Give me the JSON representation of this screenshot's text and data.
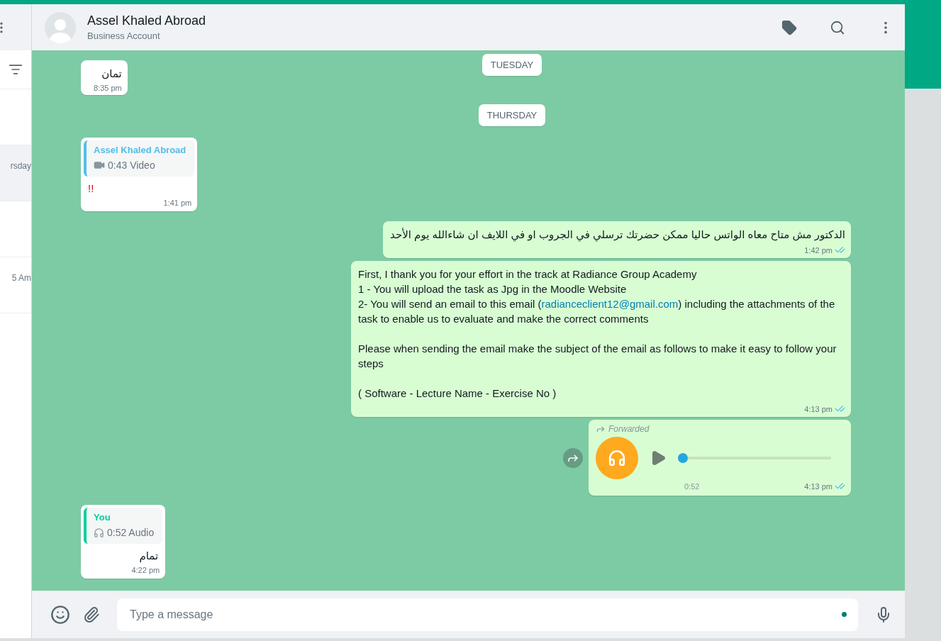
{
  "sidebar": {
    "items": [
      {
        "selected": false
      },
      {
        "time": "rsday",
        "selected": true
      },
      {
        "selected": false
      },
      {
        "time": "5 Am",
        "selected": false
      }
    ]
  },
  "header": {
    "name": "Assel Khaled Abroad",
    "subtitle": "Business Account"
  },
  "messages": [
    {
      "kind": "incoming_text",
      "text": "تمان",
      "time": "8:35 pm"
    },
    {
      "kind": "date",
      "text": "TUESDAY"
    },
    {
      "kind": "date",
      "text": "THURSDAY"
    },
    {
      "kind": "video_reply",
      "quote_author": "Assel Khaled Abroad",
      "quote_text": "0:43 Video",
      "color": "#53bdeb",
      "text": "!!",
      "time": "1:41 pm"
    },
    {
      "kind": "outgoing_text",
      "rtl": true,
      "segments": [
        {
          "text": "الدكتور مش متاح معاه الواتس حاليا ممكن حضرتك ترسلي في الجروب او في اللايف ان شاءالله يوم الأحد"
        }
      ],
      "time": "1:42 pm",
      "read": true
    },
    {
      "kind": "outgoing_text",
      "rtl": false,
      "segments": [
        {
          "text": "First, I thank you for your effort in the track at Radiance Group Academy\n1 - You will upload the task as Jpg in the Moodle Website\n2- You will send an email to this email ("
        },
        {
          "link": "radianceclient12@gmail.com"
        },
        {
          "text": ") including the attachments of the task to enable us to evaluate and make the correct comments\n\nPlease when sending the email make the subject of the email as follows to make it easy to follow your steps\n\n( Software - Lecture Name - Exercise No )"
        }
      ],
      "time": "4:13 pm",
      "read": true
    },
    {
      "kind": "outgoing_audio",
      "forwarded": true,
      "forwarded_label": "Forwarded",
      "duration": "0:52",
      "level": 0,
      "time": "4:13 pm",
      "read": true
    },
    {
      "kind": "audio_reply",
      "quote_author": "You",
      "quote_text": "0:52 Audio",
      "color": "#06cf9c",
      "text": "تمام",
      "time": "4:22 pm"
    }
  ],
  "composer": {
    "placeholder": "Type a message"
  }
}
